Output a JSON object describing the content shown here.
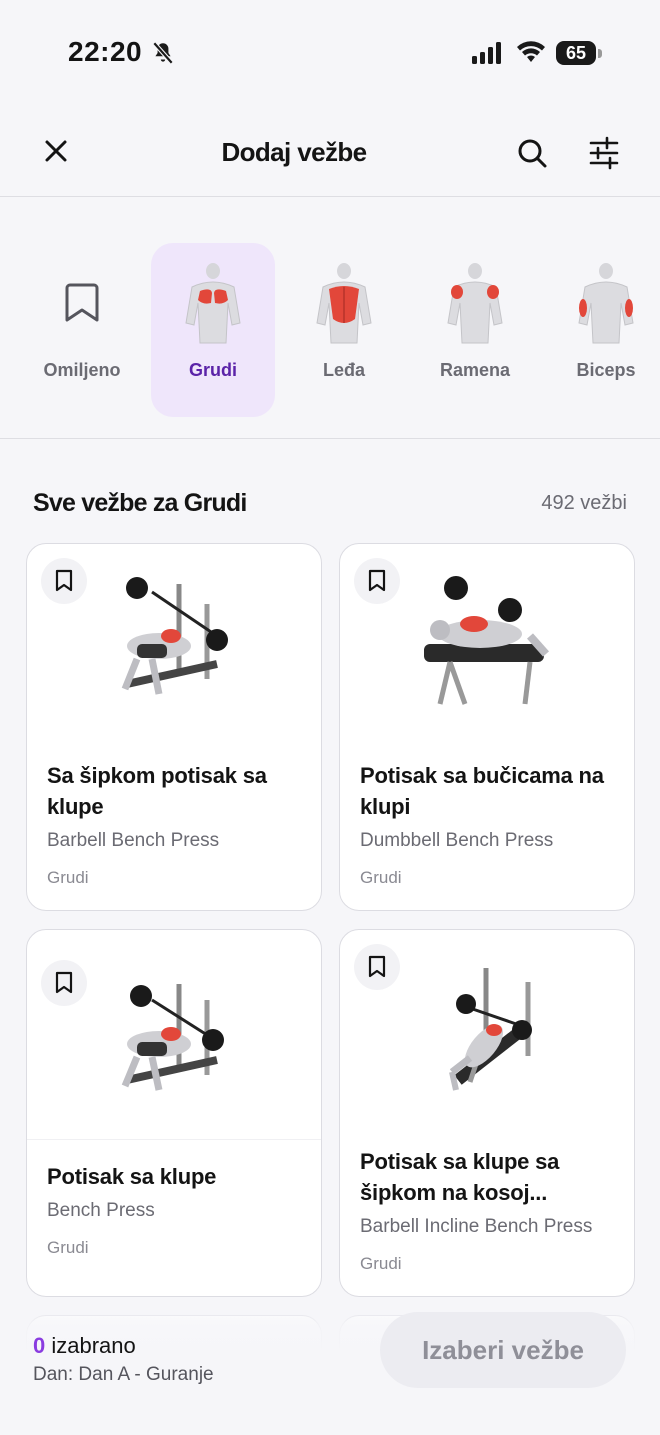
{
  "status_bar": {
    "time": "22:20",
    "battery": "65"
  },
  "header": {
    "title": "Dodaj vežbe"
  },
  "categories": [
    {
      "label": "Omiljeno",
      "active": false
    },
    {
      "label": "Grudi",
      "active": true
    },
    {
      "label": "Leđa",
      "active": false
    },
    {
      "label": "Ramena",
      "active": false
    },
    {
      "label": "Biceps",
      "active": false
    }
  ],
  "section": {
    "title": "Sve vežbe za Grudi",
    "count": "492 vežbi"
  },
  "exercises": [
    {
      "name_line1": "Sa šipkom potisak sa",
      "name_line2": "klupe",
      "name_en": "Barbell Bench Press",
      "muscle": "Grudi"
    },
    {
      "name_line1": "Potisak sa bučicama na",
      "name_line2": "klupi",
      "name_en": "Dumbbell Bench Press",
      "muscle": "Grudi"
    },
    {
      "name_line1": "Potisak sa klupe",
      "name_line2": "",
      "name_en": "Bench Press",
      "muscle": "Grudi"
    },
    {
      "name_line1": "Potisak sa klupe sa",
      "name_line2": "šipkom na kosoj...",
      "name_en": "Barbell Incline Bench Press",
      "muscle": "Grudi"
    }
  ],
  "bottom_bar": {
    "selected_count": "0",
    "selected_label": "izabrano",
    "day": "Dan: Dan A - Guranje",
    "button": "Izaberi vežbe"
  },
  "colors": {
    "accent": "#5b23a8",
    "accent_bg": "#efe6fb",
    "muscle_highlight": "#e2473a",
    "count_purple": "#8a3ce0"
  }
}
